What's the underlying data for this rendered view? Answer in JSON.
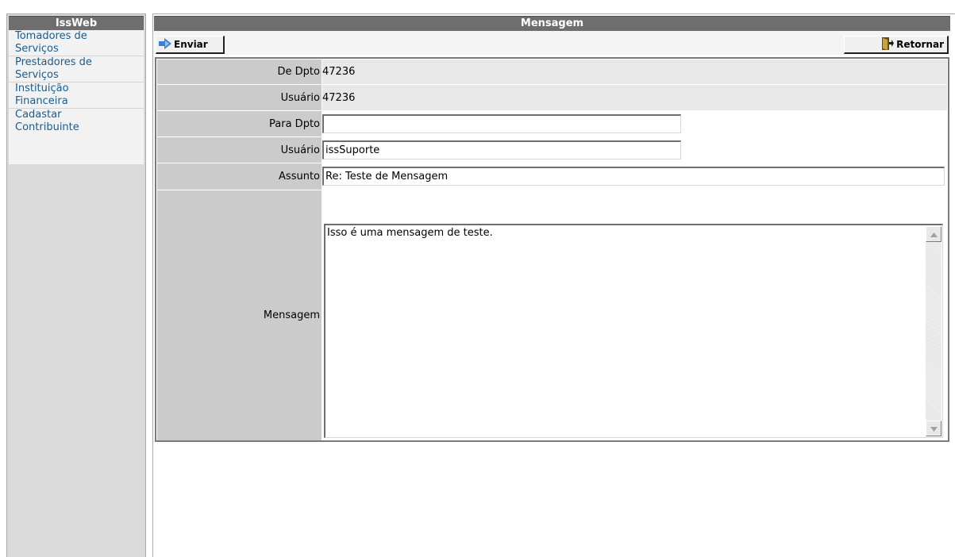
{
  "sidebar": {
    "title": "IssWeb",
    "items": [
      {
        "line1": "Tomadores de",
        "line2": "Serviços"
      },
      {
        "line1": "Prestadores de",
        "line2": "Serviços"
      },
      {
        "line1": "Instituição",
        "line2": "Financeira"
      },
      {
        "line1": "Cadastar",
        "line2": "Contribuinte"
      }
    ]
  },
  "main": {
    "title": "Mensagem",
    "toolbar": {
      "send_label": "Enviar",
      "send_icon": "arrow-right-icon",
      "back_label": "Retornar",
      "back_icon": "door-exit-icon"
    },
    "form": {
      "de_dpto_label": "De Dpto",
      "de_dpto_value": "47236",
      "usuario_from_label": "Usuário",
      "usuario_from_value": "47236",
      "para_dpto_label": "Para Dpto",
      "para_dpto_value": "",
      "usuario_to_label": "Usuário",
      "usuario_to_value": "issSuporte",
      "assunto_label": "Assunto",
      "assunto_value": "Re: Teste de Mensagem",
      "mensagem_label": "Mensagem",
      "mensagem_value": "Isso é uma mensagem de teste."
    }
  },
  "colors": {
    "title_bar": "#6e6e6e",
    "link": "#1a5d8c",
    "label_bg": "#cbcbcb",
    "value_bg": "#e8e8e8"
  }
}
